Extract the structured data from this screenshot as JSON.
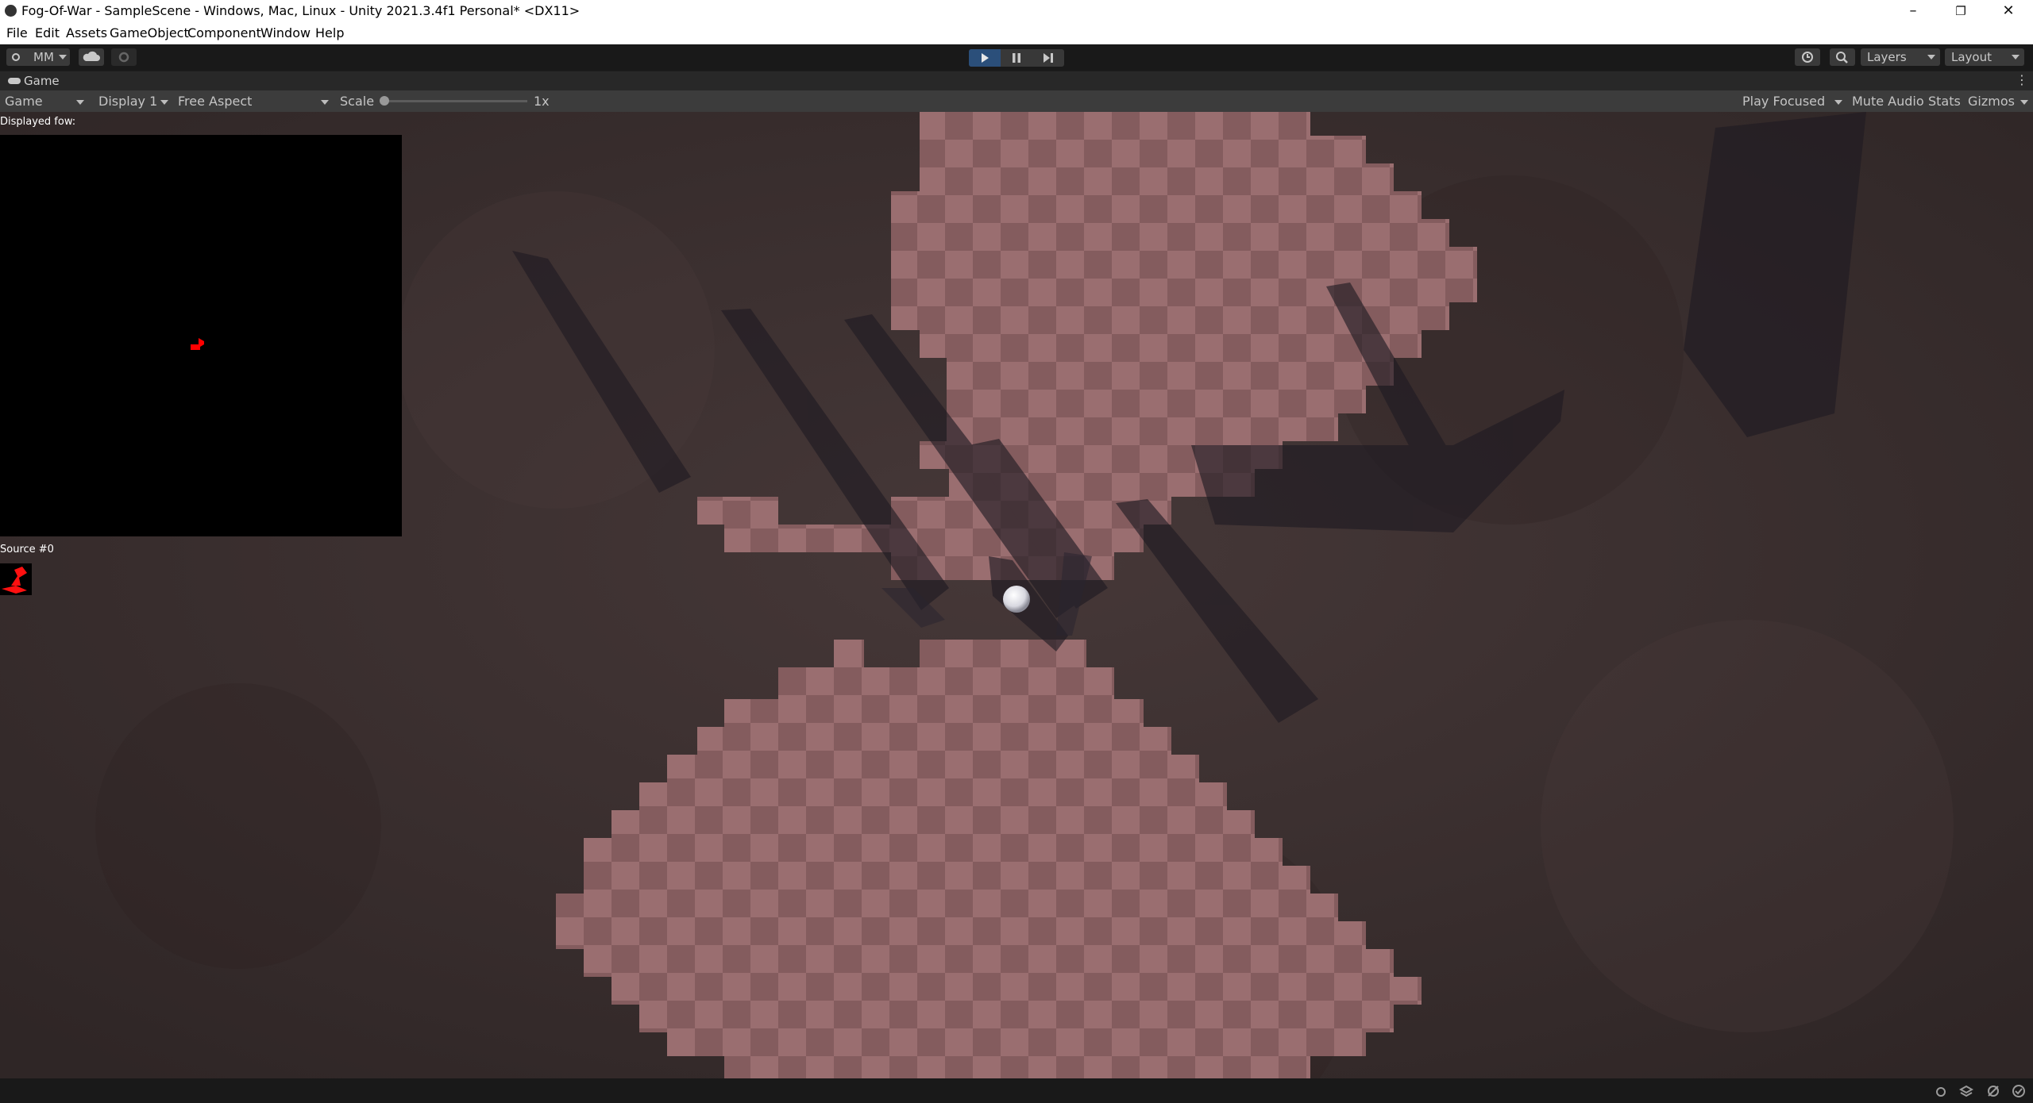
{
  "window": {
    "title": "Fog-Of-War - SampleScene - Windows, Mac, Linux - Unity 2021.3.4f1 Personal* <DX11>",
    "controls": {
      "minimize": "–",
      "maximize": "❐",
      "close": "✕"
    }
  },
  "menu": {
    "items": [
      "File",
      "Edit",
      "Assets",
      "GameObject",
      "Component",
      "Window",
      "Help"
    ]
  },
  "toolbar": {
    "account_label": "MM",
    "layers_label": "Layers",
    "layout_label": "Layout",
    "play_active": true
  },
  "game_tab": {
    "label": "Game"
  },
  "game_bar": {
    "view_select": "Game",
    "display_select": "Display 1",
    "aspect_select": "Free Aspect",
    "scale_label": "Scale",
    "scale_value": "1x",
    "play_mode_select": "Play Focused",
    "mute_label": "Mute Audio",
    "stats_label": "Stats",
    "gizmos_label": "Gizmos"
  },
  "viewport": {
    "displayed_fow_label": "Displayed fow:",
    "source_label": "Source #0",
    "colors": {
      "ground": "#3a2f2f",
      "revealed_light": "#9a6e70",
      "revealed_dark": "#845c5e",
      "fow_panel": "#000000",
      "source_marker": "#ff0000"
    }
  }
}
